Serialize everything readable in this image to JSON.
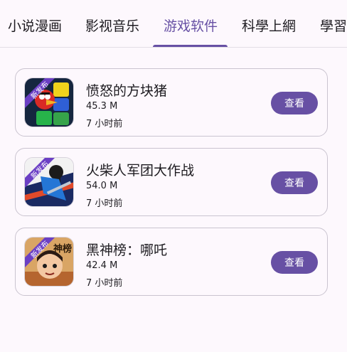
{
  "tabs": [
    {
      "label": "小说漫画"
    },
    {
      "label": "影视音乐"
    },
    {
      "label": "游戏软件"
    },
    {
      "label": "科學上網"
    },
    {
      "label": "學習"
    }
  ],
  "active_tab": "游戏软件",
  "colors": {
    "accent": "#6750a4",
    "background": "#fdf8fd",
    "card_border": "#cac4d0"
  },
  "apps": [
    {
      "name": "愤怒的方块猪",
      "size": "45.3 M",
      "time": "7 小时前",
      "badge": "新发布",
      "action": "查看",
      "icon": "angry-bird-blocks-icon"
    },
    {
      "name": "火柴人军团大作战",
      "size": "54.0 M",
      "time": "7 小时前",
      "badge": "新发布",
      "action": "查看",
      "icon": "stickman-hero-icon"
    },
    {
      "name": "黑神榜：哪吒",
      "size": "42.4 M",
      "time": "7 小时前",
      "badge": "新发布",
      "action": "查看",
      "icon": "nezha-character-icon",
      "icon_text": "神榜"
    }
  ]
}
